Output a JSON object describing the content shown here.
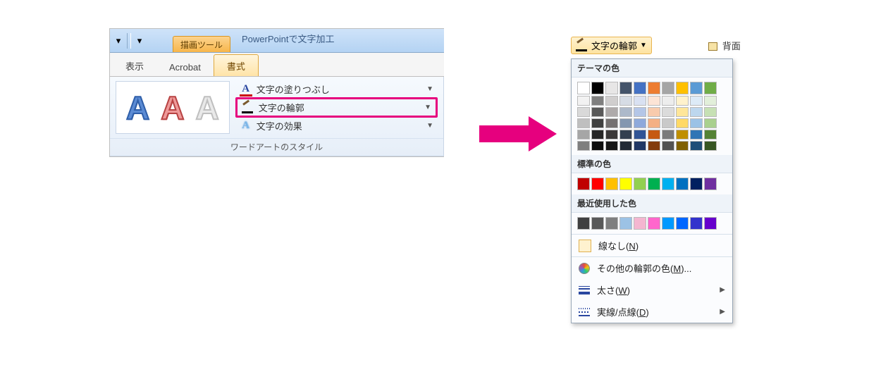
{
  "ribbon": {
    "contextual_label": "描画ツール",
    "window_title": "PowerPointで文字加工",
    "tabs": {
      "view": "表示",
      "acrobat": "Acrobat",
      "format": "書式"
    },
    "wordart_group": {
      "caption": "ワードアートのスタイル",
      "sample_glyphs": [
        "A",
        "A",
        "A"
      ],
      "fill_label": "文字の塗りつぶし",
      "outline_label": "文字の輪郭",
      "effects_label": "文字の効果"
    }
  },
  "right": {
    "outline_button": "文字の輪郭",
    "send_back": "背面",
    "sections": {
      "theme": "テーマの色",
      "standard": "標準の色",
      "recent": "最近使用した色"
    },
    "theme_base": [
      "#ffffff",
      "#000000",
      "#e7e6e6",
      "#44546a",
      "#4472c4",
      "#ed7d31",
      "#a5a5a5",
      "#ffc000",
      "#5b9bd5",
      "#70ad47"
    ],
    "theme_shades": [
      [
        "#f2f2f2",
        "#d9d9d9",
        "#bfbfbf",
        "#a6a6a6",
        "#7f7f7f"
      ],
      [
        "#7f7f7f",
        "#595959",
        "#404040",
        "#262626",
        "#0d0d0d"
      ],
      [
        "#d0cece",
        "#aeaaaa",
        "#757171",
        "#3a3838",
        "#161616"
      ],
      [
        "#d6dce5",
        "#adb9ca",
        "#8497b0",
        "#333f50",
        "#222a35"
      ],
      [
        "#d9e1f2",
        "#b4c6e7",
        "#8ea9db",
        "#305496",
        "#203764"
      ],
      [
        "#fce4d6",
        "#f8cbad",
        "#f4b084",
        "#c65911",
        "#833c0c"
      ],
      [
        "#ededed",
        "#dbdbdb",
        "#c9c9c9",
        "#7b7b7b",
        "#525252"
      ],
      [
        "#fff2cc",
        "#ffe699",
        "#ffd966",
        "#bf8f00",
        "#806000"
      ],
      [
        "#ddebf7",
        "#bdd7ee",
        "#9bc2e6",
        "#2f75b5",
        "#1f4e78"
      ],
      [
        "#e2efda",
        "#c6e0b4",
        "#a9d08e",
        "#548235",
        "#375623"
      ]
    ],
    "standard_colors": [
      "#c00000",
      "#ff0000",
      "#ffc000",
      "#ffff00",
      "#92d050",
      "#00b050",
      "#00b0f0",
      "#0070c0",
      "#002060",
      "#7030a0"
    ],
    "recent_colors": [
      "#404040",
      "#595959",
      "#7f7f7f",
      "#9cc2e5",
      "#f4b6d0",
      "#ff66cc",
      "#0099ff",
      "#0066ff",
      "#3333cc",
      "#6600cc"
    ],
    "menu": {
      "no_line_pre": "線なし(",
      "no_line_mn": "N",
      "no_line_post": ")",
      "more_pre": "その他の輪郭の色(",
      "more_mn": "M",
      "more_post": ")...",
      "weight_pre": "太さ(",
      "weight_mn": "W",
      "weight_post": ")",
      "dash_pre": "実線/点線(",
      "dash_mn": "D",
      "dash_post": ")"
    }
  }
}
